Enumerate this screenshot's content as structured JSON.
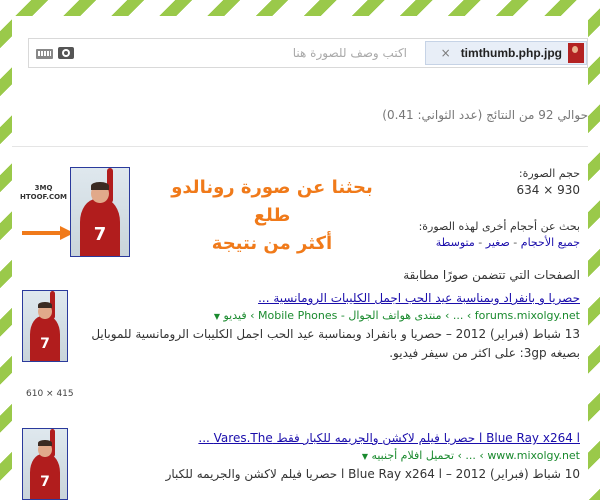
{
  "search": {
    "chip_filename": "timthumb.php.jpg",
    "chip_close": "×",
    "placeholder": "اكتب وصف للصورة هنا"
  },
  "results_count": "حوالي 92 من النتائج (عدد الثواني: 0.41)",
  "image_info": {
    "size_label": "حجم الصورة:",
    "size_value": "634 × 930",
    "other_sizes_label": "بحث عن أحجام أخرى لهذه الصورة:",
    "size_links": [
      "جميع الأحجام",
      "صغير",
      "متوسطة"
    ],
    "size_link_sep": " - "
  },
  "promo": {
    "line1": "بحثنا عن صورة رونالدو طلع",
    "line2": "أكثر من نتيجة"
  },
  "watermark": {
    "line1": "3MQ",
    "line2": "HTOOF.COM"
  },
  "thumb_jersey_number": "7",
  "pages_heading": "الصفحات التي تتضمن صورًا مطابقة",
  "results": [
    {
      "title": "حصريا و بانفراد وبمناسبة عيد الحب اجمل الكليبات الرومانسية ...",
      "url_main": "forums.mixolgy.net",
      "url_path": " › ... › منتدى هواتف الجوال - Mobile Phones › فيديو",
      "snippet": "13 شباط (فبراير) 2012 – حصريا و بانفراد وبمناسبة عيد الحب اجمل الكليبات الرومانسية للموبايل بصيغه 3gp: على اكثر من سيفر فيديو.",
      "dims": "610 × 415"
    },
    {
      "title": "l Blue Ray x264 l حصريا فيلم لاكشن والجريمه للكبار فقط Vares.The ...",
      "url_main": "www.mixolgy.net",
      "url_path": " › ... › تحميل افلام أجنبيه",
      "snippet": "10 شباط (فبراير) 2012 – l Blue Ray x264 l حصريا فيلم لاكشن والجريمه للكبار",
      "dims": ""
    }
  ],
  "colors": {
    "stripe": "#9ac94a",
    "link": "#1a0dab",
    "url": "#1a8a2e",
    "promo": "#f07a1a",
    "jersey": "#b11d1d"
  },
  "icons": {
    "camera": "camera-icon",
    "keyboard": "keyboard-icon",
    "arrow": "arrow-right-icon"
  }
}
